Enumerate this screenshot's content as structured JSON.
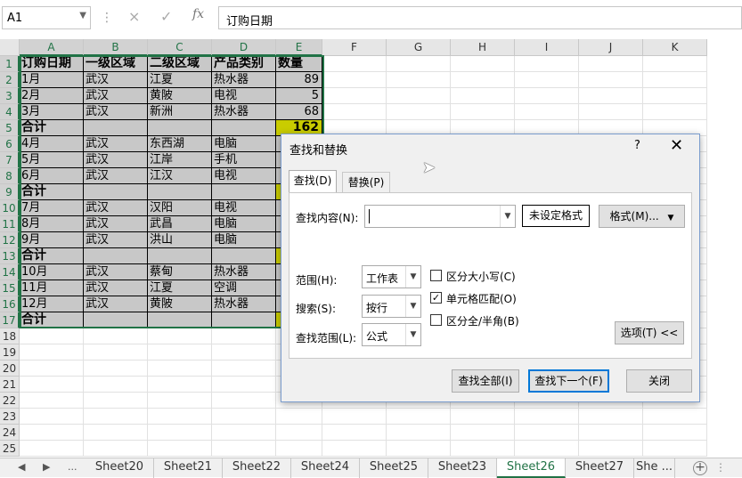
{
  "formula_bar": {
    "name_box": "A1",
    "cancel_glyph": "×",
    "enter_glyph": "✓",
    "fx_label": "fx",
    "formula": "订购日期"
  },
  "columns": [
    "A",
    "B",
    "C",
    "D",
    "E",
    "F",
    "G",
    "H",
    "I",
    "J",
    "K"
  ],
  "rows": [
    "1",
    "2",
    "3",
    "4",
    "5",
    "6",
    "7",
    "8",
    "9",
    "10",
    "11",
    "12",
    "13",
    "14",
    "15",
    "16",
    "17",
    "18",
    "19",
    "20",
    "21",
    "22",
    "23",
    "24",
    "25"
  ],
  "table": [
    [
      "订购日期",
      "一级区域",
      "二级区域",
      "产品类别",
      "数量"
    ],
    [
      "1月",
      "武汉",
      "江夏",
      "热水器",
      "89"
    ],
    [
      "2月",
      "武汉",
      "黄陂",
      "电视",
      "5"
    ],
    [
      "3月",
      "武汉",
      "新洲",
      "热水器",
      "68"
    ],
    [
      "合计",
      "",
      "",
      "",
      "162"
    ],
    [
      "4月",
      "武汉",
      "东西湖",
      "电脑",
      ""
    ],
    [
      "5月",
      "武汉",
      "江岸",
      "手机",
      ""
    ],
    [
      "6月",
      "武汉",
      "江汉",
      "电视",
      ""
    ],
    [
      "合计",
      "",
      "",
      "",
      ""
    ],
    [
      "7月",
      "武汉",
      "汉阳",
      "电视",
      ""
    ],
    [
      "8月",
      "武汉",
      "武昌",
      "电脑",
      ""
    ],
    [
      "9月",
      "武汉",
      "洪山",
      "电脑",
      ""
    ],
    [
      "合计",
      "",
      "",
      "",
      ""
    ],
    [
      "10月",
      "武汉",
      "蔡甸",
      "热水器",
      ""
    ],
    [
      "11月",
      "武汉",
      "江夏",
      "空调",
      ""
    ],
    [
      "12月",
      "武汉",
      "黄陂",
      "热水器",
      ""
    ],
    [
      "合计",
      "",
      "",
      "",
      ""
    ]
  ],
  "sheet_tabs": {
    "nav_more": "...",
    "items": [
      "Sheet20",
      "Sheet21",
      "Sheet22",
      "Sheet24",
      "Sheet25",
      "Sheet23",
      "Sheet26",
      "Sheet27",
      "She ..."
    ],
    "active": "Sheet26",
    "add_glyph": "+"
  },
  "dialog": {
    "title": "查找和替换",
    "help": "?",
    "close": "✕",
    "tab_find": "查找(D)",
    "tab_replace": "替换(P)",
    "find_label": "查找内容(N):",
    "find_value": "",
    "format_preview": "未设定格式",
    "format_button": "格式(M)...",
    "scope_label": "范围(H):",
    "scope_value": "工作表",
    "search_label": "搜索(S):",
    "search_value": "按行",
    "lookin_label": "查找范围(L):",
    "lookin_value": "公式",
    "match_case": {
      "label": "区分大小写(C)",
      "checked": false
    },
    "match_cell": {
      "label": "单元格匹配(O)",
      "checked": true
    },
    "match_width": {
      "label": "区分全/半角(B)",
      "checked": false
    },
    "options_button": "选项(T) <<",
    "find_all_button": "查找全部(I)",
    "find_next_button": "查找下一个(F)",
    "close_button": "关闭"
  },
  "colors": {
    "accent": "#217346",
    "data_fill": "#c8c8c8",
    "total_fill": "#c9cc00",
    "dialog_border": "#7a9ccd"
  }
}
